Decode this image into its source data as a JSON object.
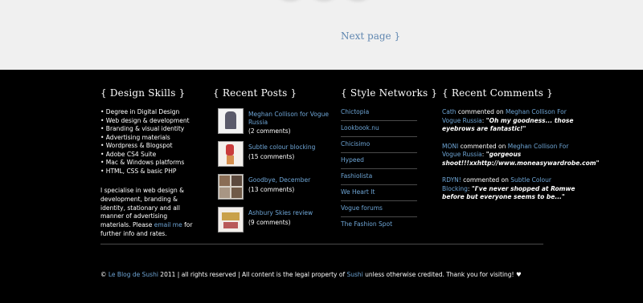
{
  "pagination": {
    "next_label": "Next page }"
  },
  "skills": {
    "heading": "{ Design Skills }",
    "items": [
      "• Degree in Digital Design",
      "• Web design & development",
      "• Branding & visual identity",
      "• Advertising materials",
      "• Wordpress & Blogspot",
      "• Adobe CS4 Suite",
      "• Mac & Windows platforms",
      "• HTML, CSS & basic PHP"
    ],
    "blurb_before": "I specialise in web design & development, branding & identity, stationary and all manner of advertising materials. Please ",
    "blurb_link": "email me",
    "blurb_after": " for further info and rates."
  },
  "posts": {
    "heading": "{ Recent Posts }",
    "items": [
      {
        "title": "Meghan Collison for Vogue Russia",
        "count": "(2 comments)"
      },
      {
        "title": "Subtle colour blocking",
        "count": "(15 comments)"
      },
      {
        "title": "Goodbye, December",
        "count": "(13 comments)"
      },
      {
        "title": "Ashbury Skies review",
        "count": "(9 comments)"
      }
    ]
  },
  "networks": {
    "heading": "{ Style Networks }",
    "items": [
      "Chictopia",
      "Lookbook.nu",
      "Chicisimo",
      "Hypeed",
      "Fashiolista",
      "We Heart It",
      "Vogue forums",
      "The Fashion Spot"
    ]
  },
  "comments": {
    "heading": "{ Recent Comments }",
    "items": [
      {
        "author": "Cath",
        "mid": " commented on ",
        "post": "Meghan Collison For Vogue Russia",
        "quote": "\"Oh my goodness... those eyebrows are fantastic!\""
      },
      {
        "author": "MONI",
        "mid": " commented on ",
        "post": "Meghan Collison For Vogue Russia",
        "quote": "\"gorgeous shoot!!!xxhttp://www.moneasywardrobe.com\""
      },
      {
        "author": "RDYN!",
        "mid": " commented on ",
        "post": "Subtle Colour Blocking",
        "quote": "\"I've never shopped at Romwe before but everyone seems to be...\""
      }
    ]
  },
  "footer": {
    "copy_prefix": "© ",
    "site_link": "Le Blog de Sushi",
    "copy_mid": " 2011 | all rights reserved | All content is the legal property of ",
    "owner_link": "Sushi",
    "copy_suffix": " unless otherwise credited. Thank you for visiting! ♥"
  },
  "colors": {
    "link": "#6ea5d5",
    "pagination_link": "#5f86b0",
    "footer_bg": "#000000",
    "top_bg": "#f0f0f0"
  }
}
